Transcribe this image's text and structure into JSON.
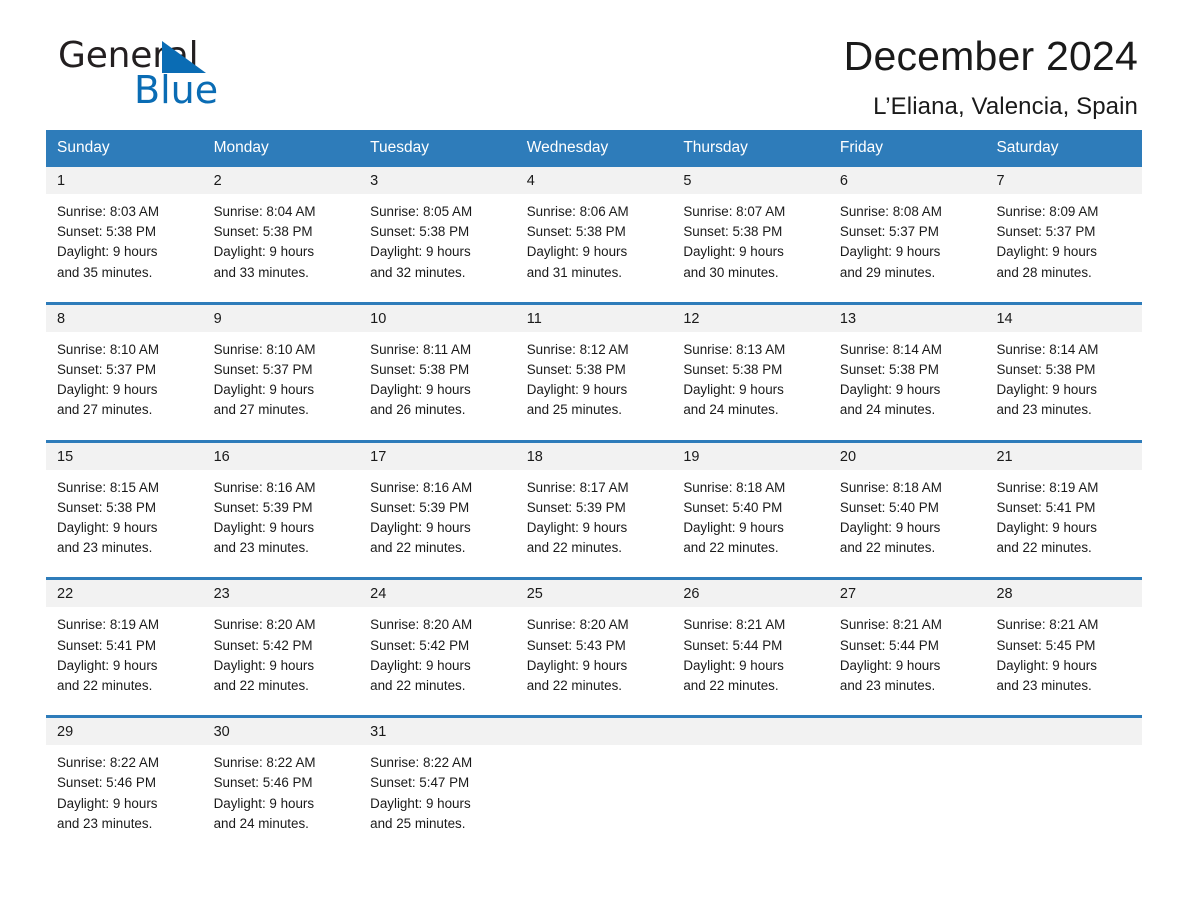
{
  "brand": {
    "name_part1": "General",
    "name_part2": "Blue",
    "accent_color": "#0a6cb4"
  },
  "header": {
    "title": "December 2024",
    "subtitle": "L’Eliana, Valencia, Spain"
  },
  "calendar": {
    "header_bg": "#2e7cba",
    "day_band_bg": "#f2f2f2",
    "weekday_headers": [
      "Sunday",
      "Monday",
      "Tuesday",
      "Wednesday",
      "Thursday",
      "Friday",
      "Saturday"
    ],
    "weeks": [
      [
        {
          "date": "1",
          "sunrise": "Sunrise: 8:03 AM",
          "sunset": "Sunset: 5:38 PM",
          "daylight_line1": "Daylight: 9 hours",
          "daylight_line2": "and 35 minutes."
        },
        {
          "date": "2",
          "sunrise": "Sunrise: 8:04 AM",
          "sunset": "Sunset: 5:38 PM",
          "daylight_line1": "Daylight: 9 hours",
          "daylight_line2": "and 33 minutes."
        },
        {
          "date": "3",
          "sunrise": "Sunrise: 8:05 AM",
          "sunset": "Sunset: 5:38 PM",
          "daylight_line1": "Daylight: 9 hours",
          "daylight_line2": "and 32 minutes."
        },
        {
          "date": "4",
          "sunrise": "Sunrise: 8:06 AM",
          "sunset": "Sunset: 5:38 PM",
          "daylight_line1": "Daylight: 9 hours",
          "daylight_line2": "and 31 minutes."
        },
        {
          "date": "5",
          "sunrise": "Sunrise: 8:07 AM",
          "sunset": "Sunset: 5:38 PM",
          "daylight_line1": "Daylight: 9 hours",
          "daylight_line2": "and 30 minutes."
        },
        {
          "date": "6",
          "sunrise": "Sunrise: 8:08 AM",
          "sunset": "Sunset: 5:37 PM",
          "daylight_line1": "Daylight: 9 hours",
          "daylight_line2": "and 29 minutes."
        },
        {
          "date": "7",
          "sunrise": "Sunrise: 8:09 AM",
          "sunset": "Sunset: 5:37 PM",
          "daylight_line1": "Daylight: 9 hours",
          "daylight_line2": "and 28 minutes."
        }
      ],
      [
        {
          "date": "8",
          "sunrise": "Sunrise: 8:10 AM",
          "sunset": "Sunset: 5:37 PM",
          "daylight_line1": "Daylight: 9 hours",
          "daylight_line2": "and 27 minutes."
        },
        {
          "date": "9",
          "sunrise": "Sunrise: 8:10 AM",
          "sunset": "Sunset: 5:37 PM",
          "daylight_line1": "Daylight: 9 hours",
          "daylight_line2": "and 27 minutes."
        },
        {
          "date": "10",
          "sunrise": "Sunrise: 8:11 AM",
          "sunset": "Sunset: 5:38 PM",
          "daylight_line1": "Daylight: 9 hours",
          "daylight_line2": "and 26 minutes."
        },
        {
          "date": "11",
          "sunrise": "Sunrise: 8:12 AM",
          "sunset": "Sunset: 5:38 PM",
          "daylight_line1": "Daylight: 9 hours",
          "daylight_line2": "and 25 minutes."
        },
        {
          "date": "12",
          "sunrise": "Sunrise: 8:13 AM",
          "sunset": "Sunset: 5:38 PM",
          "daylight_line1": "Daylight: 9 hours",
          "daylight_line2": "and 24 minutes."
        },
        {
          "date": "13",
          "sunrise": "Sunrise: 8:14 AM",
          "sunset": "Sunset: 5:38 PM",
          "daylight_line1": "Daylight: 9 hours",
          "daylight_line2": "and 24 minutes."
        },
        {
          "date": "14",
          "sunrise": "Sunrise: 8:14 AM",
          "sunset": "Sunset: 5:38 PM",
          "daylight_line1": "Daylight: 9 hours",
          "daylight_line2": "and 23 minutes."
        }
      ],
      [
        {
          "date": "15",
          "sunrise": "Sunrise: 8:15 AM",
          "sunset": "Sunset: 5:38 PM",
          "daylight_line1": "Daylight: 9 hours",
          "daylight_line2": "and 23 minutes."
        },
        {
          "date": "16",
          "sunrise": "Sunrise: 8:16 AM",
          "sunset": "Sunset: 5:39 PM",
          "daylight_line1": "Daylight: 9 hours",
          "daylight_line2": "and 23 minutes."
        },
        {
          "date": "17",
          "sunrise": "Sunrise: 8:16 AM",
          "sunset": "Sunset: 5:39 PM",
          "daylight_line1": "Daylight: 9 hours",
          "daylight_line2": "and 22 minutes."
        },
        {
          "date": "18",
          "sunrise": "Sunrise: 8:17 AM",
          "sunset": "Sunset: 5:39 PM",
          "daylight_line1": "Daylight: 9 hours",
          "daylight_line2": "and 22 minutes."
        },
        {
          "date": "19",
          "sunrise": "Sunrise: 8:18 AM",
          "sunset": "Sunset: 5:40 PM",
          "daylight_line1": "Daylight: 9 hours",
          "daylight_line2": "and 22 minutes."
        },
        {
          "date": "20",
          "sunrise": "Sunrise: 8:18 AM",
          "sunset": "Sunset: 5:40 PM",
          "daylight_line1": "Daylight: 9 hours",
          "daylight_line2": "and 22 minutes."
        },
        {
          "date": "21",
          "sunrise": "Sunrise: 8:19 AM",
          "sunset": "Sunset: 5:41 PM",
          "daylight_line1": "Daylight: 9 hours",
          "daylight_line2": "and 22 minutes."
        }
      ],
      [
        {
          "date": "22",
          "sunrise": "Sunrise: 8:19 AM",
          "sunset": "Sunset: 5:41 PM",
          "daylight_line1": "Daylight: 9 hours",
          "daylight_line2": "and 22 minutes."
        },
        {
          "date": "23",
          "sunrise": "Sunrise: 8:20 AM",
          "sunset": "Sunset: 5:42 PM",
          "daylight_line1": "Daylight: 9 hours",
          "daylight_line2": "and 22 minutes."
        },
        {
          "date": "24",
          "sunrise": "Sunrise: 8:20 AM",
          "sunset": "Sunset: 5:42 PM",
          "daylight_line1": "Daylight: 9 hours",
          "daylight_line2": "and 22 minutes."
        },
        {
          "date": "25",
          "sunrise": "Sunrise: 8:20 AM",
          "sunset": "Sunset: 5:43 PM",
          "daylight_line1": "Daylight: 9 hours",
          "daylight_line2": "and 22 minutes."
        },
        {
          "date": "26",
          "sunrise": "Sunrise: 8:21 AM",
          "sunset": "Sunset: 5:44 PM",
          "daylight_line1": "Daylight: 9 hours",
          "daylight_line2": "and 22 minutes."
        },
        {
          "date": "27",
          "sunrise": "Sunrise: 8:21 AM",
          "sunset": "Sunset: 5:44 PM",
          "daylight_line1": "Daylight: 9 hours",
          "daylight_line2": "and 23 minutes."
        },
        {
          "date": "28",
          "sunrise": "Sunrise: 8:21 AM",
          "sunset": "Sunset: 5:45 PM",
          "daylight_line1": "Daylight: 9 hours",
          "daylight_line2": "and 23 minutes."
        }
      ],
      [
        {
          "date": "29",
          "sunrise": "Sunrise: 8:22 AM",
          "sunset": "Sunset: 5:46 PM",
          "daylight_line1": "Daylight: 9 hours",
          "daylight_line2": "and 23 minutes."
        },
        {
          "date": "30",
          "sunrise": "Sunrise: 8:22 AM",
          "sunset": "Sunset: 5:46 PM",
          "daylight_line1": "Daylight: 9 hours",
          "daylight_line2": "and 24 minutes."
        },
        {
          "date": "31",
          "sunrise": "Sunrise: 8:22 AM",
          "sunset": "Sunset: 5:47 PM",
          "daylight_line1": "Daylight: 9 hours",
          "daylight_line2": "and 25 minutes."
        },
        {
          "date": "",
          "sunrise": "",
          "sunset": "",
          "daylight_line1": "",
          "daylight_line2": ""
        },
        {
          "date": "",
          "sunrise": "",
          "sunset": "",
          "daylight_line1": "",
          "daylight_line2": ""
        },
        {
          "date": "",
          "sunrise": "",
          "sunset": "",
          "daylight_line1": "",
          "daylight_line2": ""
        },
        {
          "date": "",
          "sunrise": "",
          "sunset": "",
          "daylight_line1": "",
          "daylight_line2": ""
        }
      ]
    ]
  }
}
